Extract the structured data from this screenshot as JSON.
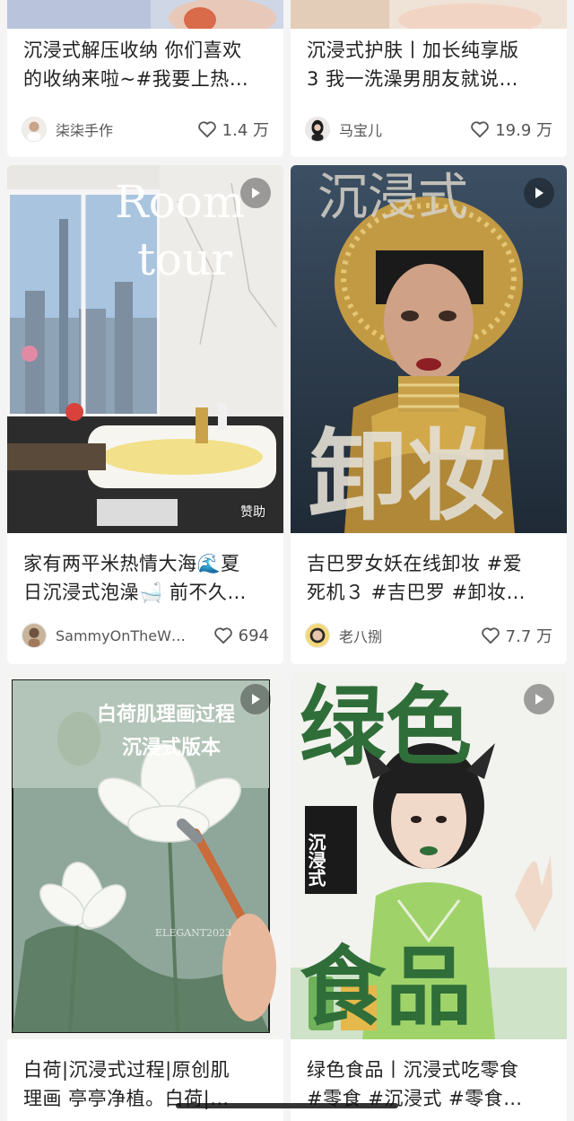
{
  "cards": [
    {
      "title_lines": [
        "沉浸式解压收纳 你们喜欢",
        "的收纳来啦~#我要上热…"
      ],
      "author": "柒柒手作",
      "likes": "1.4 万",
      "has_video": false
    },
    {
      "title_lines": [
        "沉浸式护肤丨加长纯享版",
        "3 我一洗澡男朋友就说…"
      ],
      "author": "马宝儿",
      "likes": "19.9 万",
      "has_video": false
    },
    {
      "cover_text": [
        "Room",
        "tour"
      ],
      "badge": "赞助",
      "title_lines": [
        "家有两平米热情大海🌊夏",
        "日沉浸式泡澡🛁 前不久…"
      ],
      "author": "SammyOnTheW…",
      "likes": "694",
      "has_video": true
    },
    {
      "cover_text": [
        "沉浸式",
        "卸妆"
      ],
      "title_lines": [
        "吉巴罗女妖在线卸妆 #爱",
        "死机３ #吉巴罗 #卸妆…"
      ],
      "author": "老八捌",
      "likes": "7.7 万",
      "has_video": true
    },
    {
      "cover_text": [
        "白荷肌理画过程",
        "沉浸式版本",
        "ELEGANT2023"
      ],
      "title_lines": [
        "白荷|沉浸式过程|原创肌",
        "理画 亭亭净植。白荷|…"
      ],
      "has_video": true
    },
    {
      "cover_text": [
        "绿色",
        "食品",
        "沉浸式"
      ],
      "title_lines": [
        "绿色食品丨沉浸式吃零食",
        "#零食 #沉浸式 #零食…"
      ],
      "has_video": true
    }
  ],
  "colors": {
    "background": "#f4f4f4",
    "card": "#ffffff",
    "accent_green": "#2f6e38"
  },
  "icons": {
    "like": "heart-outline-icon",
    "video": "play-icon"
  }
}
